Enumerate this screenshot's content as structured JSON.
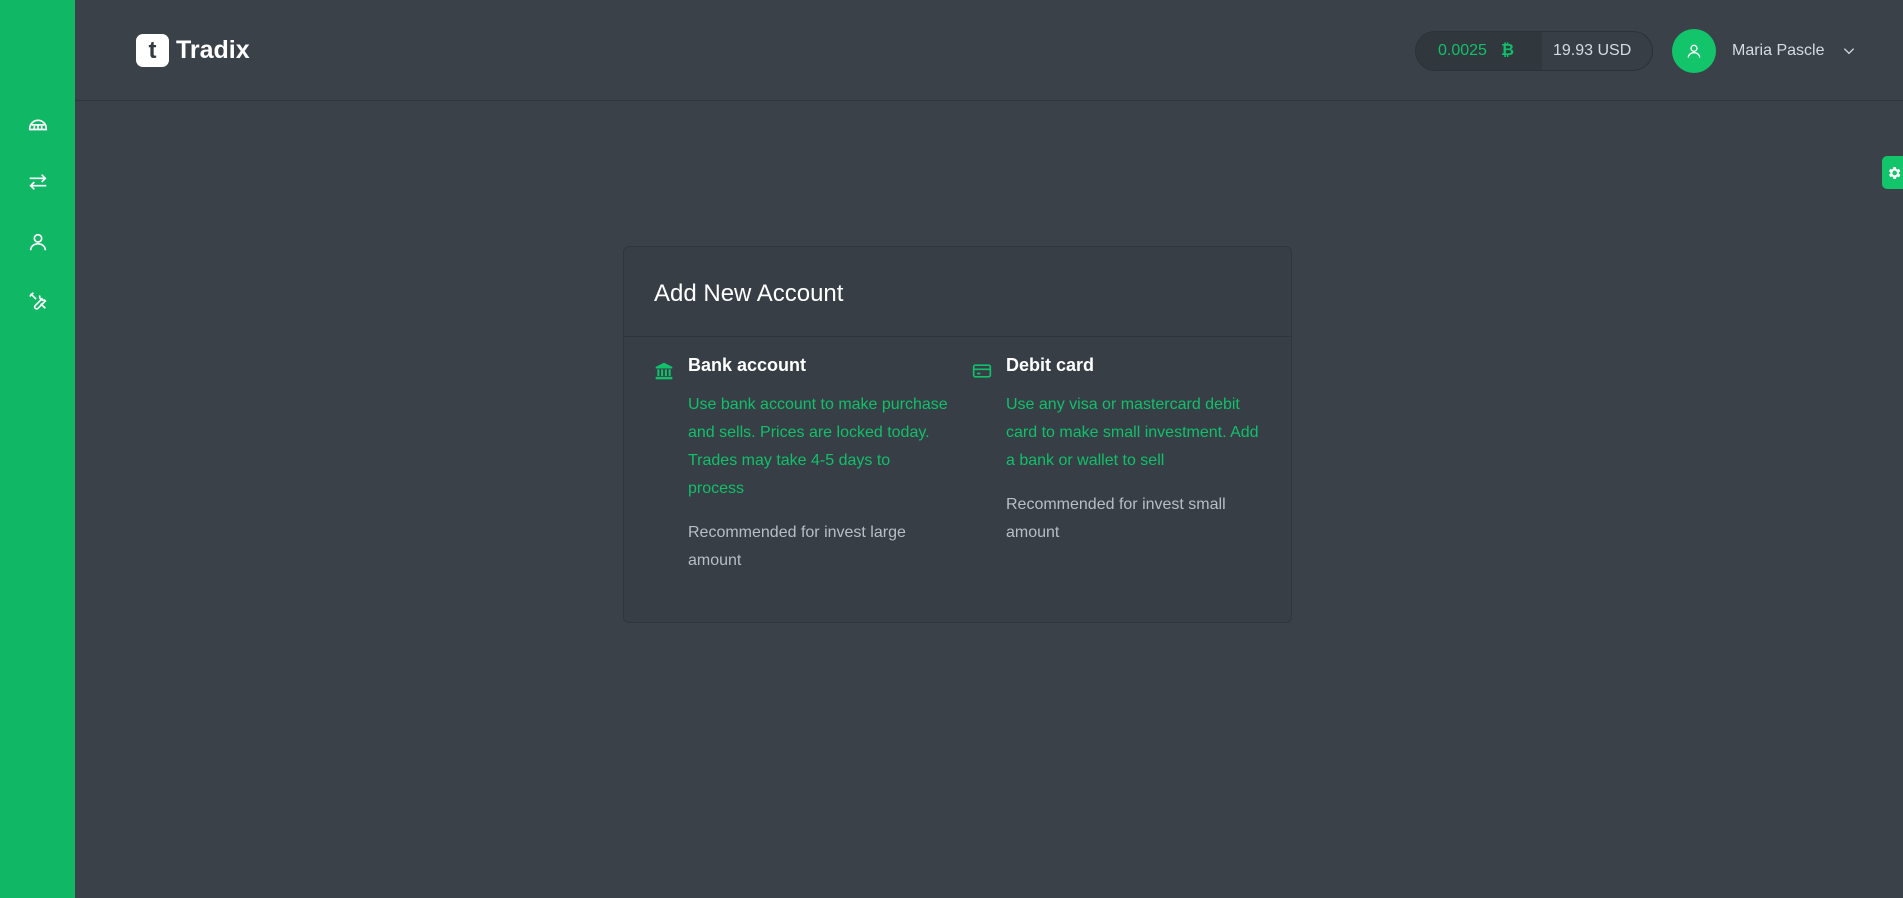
{
  "sidebar": {
    "items": [
      {
        "name": "dashboard",
        "icon": "dashboard-icon"
      },
      {
        "name": "exchange",
        "icon": "exchange-icon"
      },
      {
        "name": "profile",
        "icon": "user-icon"
      },
      {
        "name": "settings",
        "icon": "tools-icon"
      }
    ],
    "color": "#10b866"
  },
  "header": {
    "logo_letter": "t",
    "brand": "Tradix",
    "balance": {
      "btc_amount": "0.0025",
      "btc_symbol": "₿",
      "usd_amount": "19.93 USD"
    },
    "user_name": "Maria Pascle"
  },
  "card": {
    "title": "Add New Account",
    "options": [
      {
        "title": "Bank account",
        "icon": "bank-icon",
        "description": "Use bank account to make purchase and sells. Prices are locked today. Trades may take 4-5 days to process",
        "recommendation": "Recommended for invest large amount"
      },
      {
        "title": "Debit card",
        "icon": "credit-card-icon",
        "description": "Use any visa or mastercard debit card to make small investment. Add a bank or wallet to sell",
        "recommendation": "Recommended for invest small amount"
      }
    ]
  },
  "colors": {
    "accent": "#10c06a",
    "background": "#3a4149",
    "card": "#373e45"
  }
}
